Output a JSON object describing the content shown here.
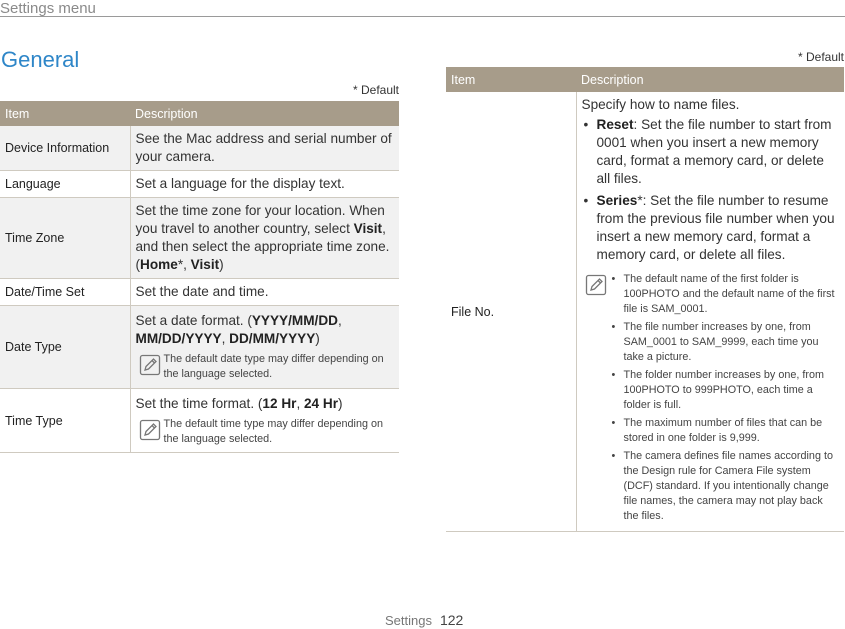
{
  "header": {
    "title": "Settings menu"
  },
  "section": {
    "title": "General"
  },
  "default_note": "* Default",
  "left_table": {
    "col_item": "Item",
    "col_desc": "Description",
    "rows": {
      "device": {
        "item": "Device Information",
        "desc": "See the Mac address and serial number of your camera."
      },
      "language": {
        "item": "Language",
        "desc": "Set a language for the display text."
      },
      "timezone": {
        "item": "Time Zone",
        "desc_pre": "Set the time zone for your location. When you travel to another country, select ",
        "visit": "Visit",
        "desc_mid": ", and then select the appropriate time zone. (",
        "home": "Home",
        "star": "*, ",
        "visit2": "Visit",
        "close": ")"
      },
      "datetime": {
        "item": "Date/Time Set",
        "desc": "Set the date and time."
      },
      "datetype": {
        "item": "Date Type",
        "desc_pre": "Set a date format. (",
        "f1": "YYYY/MM/DD",
        "sep1": ", ",
        "f2": "MM/DD/YYYY",
        "sep2": ", ",
        "f3": "DD/MM/YYYY",
        "close": ")",
        "note": "The default date type may differ depending on the language selected."
      },
      "timetype": {
        "item": "Time Type",
        "desc_pre": "Set the time format. (",
        "f1": "12 Hr",
        "sep": ", ",
        "f2": "24 Hr",
        "close": ")",
        "note": "The default time type may differ depending on the language selected."
      }
    }
  },
  "right_table": {
    "col_item": "Item",
    "col_desc": "Description",
    "fileno": {
      "item": "File No.",
      "intro": "Specify how to name files.",
      "reset_label": "Reset",
      "reset_text": ": Set the file number to start from 0001 when you insert a new memory card, format a memory card, or delete all files.",
      "series_label": "Series",
      "series_text": "*: Set the file number to resume from the previous file number when you insert a new memory card, format a memory card, or delete all files.",
      "notes": [
        "The default name of the first folder is 100PHOTO and the default name of the first file is SAM_0001.",
        "The file number increases by one, from SAM_0001 to SAM_9999, each time you take a picture.",
        "The folder number increases by one, from 100PHOTO to 999PHOTO, each time a folder is full.",
        "The maximum number of files that can be stored in one folder is 9,999.",
        "The camera defines file names according to the Design rule for Camera File system (DCF) standard. If you intentionally change file names, the camera may not play back the files."
      ]
    }
  },
  "footer": {
    "label": "Settings",
    "page": "122"
  },
  "colors": {
    "accent": "#2e86c8",
    "table_header": "#a79c8a"
  },
  "icons": {
    "note": "pencil-note-icon"
  }
}
